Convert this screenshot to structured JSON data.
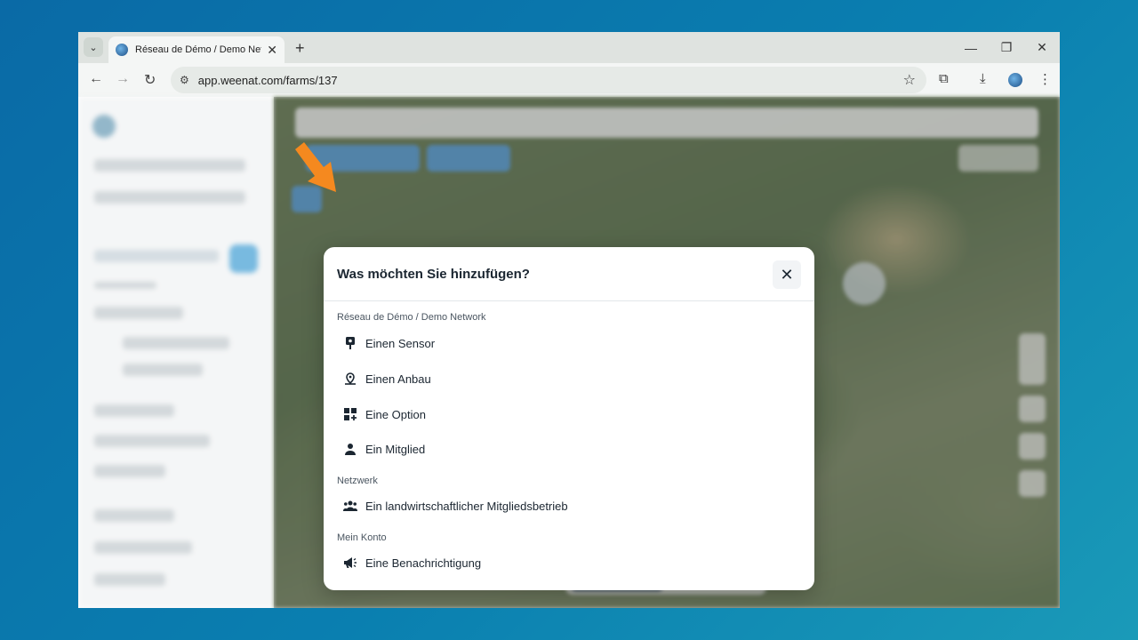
{
  "browser": {
    "tab_title": "Réseau de Démo / Demo Netw",
    "url": "app.weenat.com/farms/137"
  },
  "modal": {
    "title": "Was möchten Sie hinzufügen?",
    "sections": [
      {
        "label": "Réseau de Démo / Demo Network",
        "items": [
          {
            "label": "Einen Sensor",
            "icon": "sensor-icon"
          },
          {
            "label": "Einen Anbau",
            "icon": "plot-icon"
          },
          {
            "label": "Eine Option",
            "icon": "option-icon"
          },
          {
            "label": "Ein Mitglied",
            "icon": "member-icon"
          }
        ]
      },
      {
        "label": "Netzwerk",
        "items": [
          {
            "label": "Ein landwirtschaftlicher Mitgliedsbetrieb",
            "icon": "group-icon"
          }
        ]
      },
      {
        "label": "Mein Konto",
        "items": [
          {
            "label": "Eine Benachrichtigung",
            "icon": "megaphone-icon"
          }
        ]
      }
    ]
  },
  "colors": {
    "accent_arrow": "#f5891f",
    "modal_text": "#1b2631"
  }
}
